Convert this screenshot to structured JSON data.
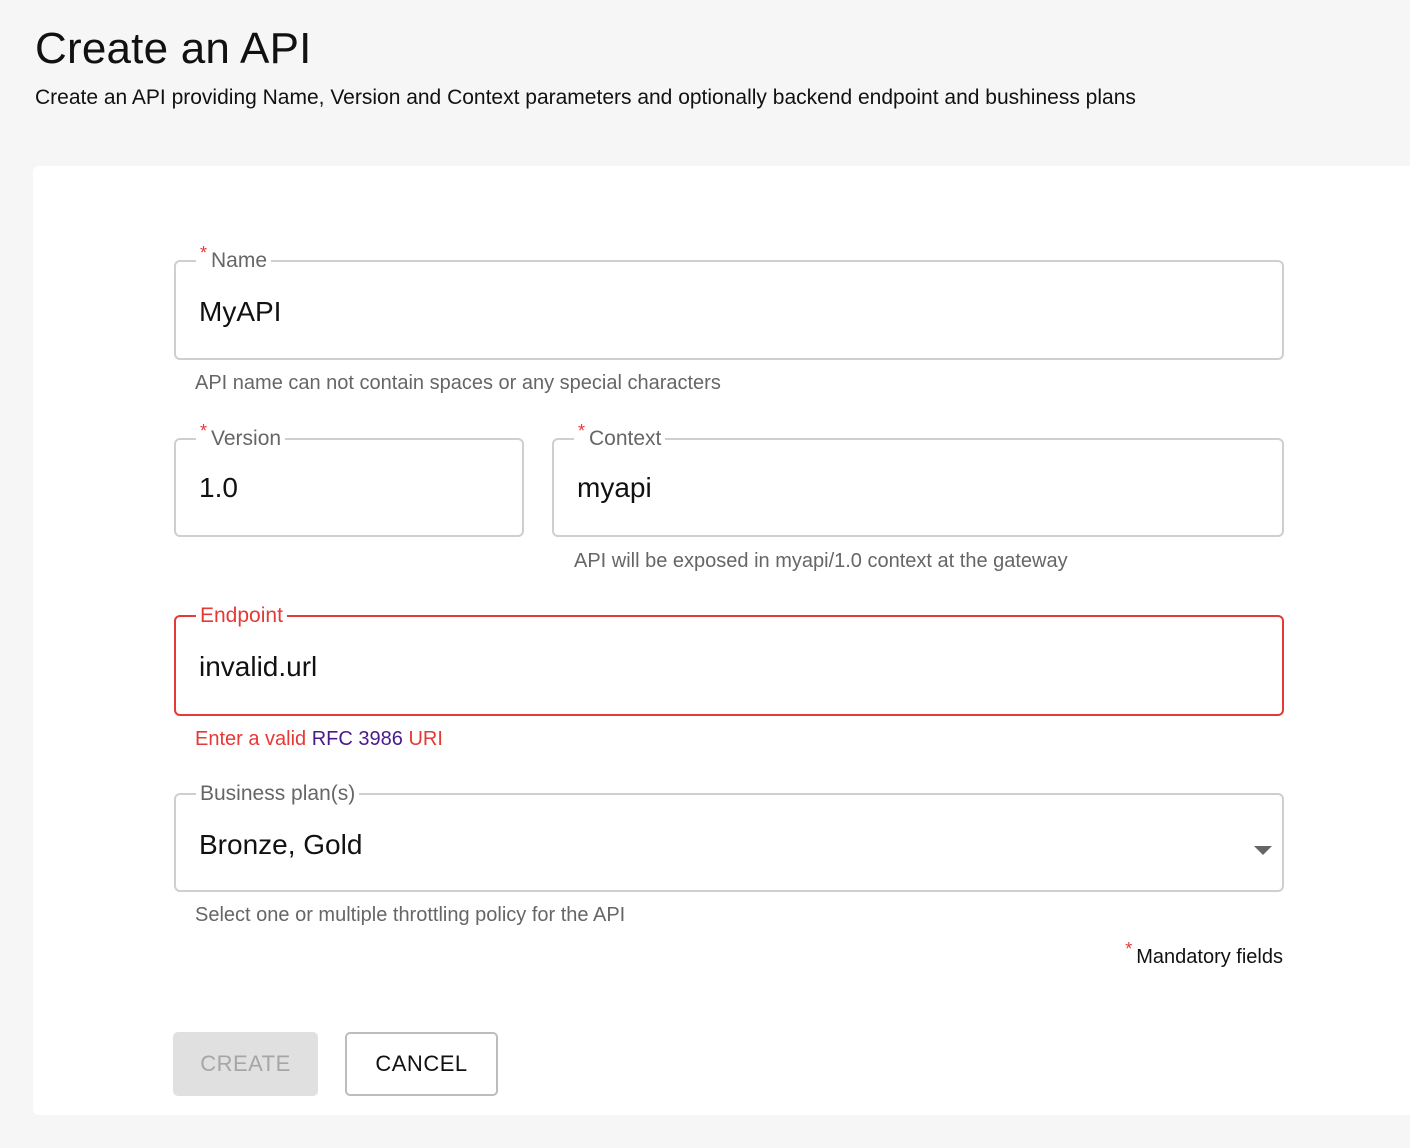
{
  "header": {
    "title": "Create an API",
    "subtitle": "Create an API providing Name, Version and Context parameters and optionally backend endpoint and bushiness plans"
  },
  "form": {
    "required_marker": "*",
    "name": {
      "label": "Name",
      "value": "MyAPI",
      "helper": "API name can not contain spaces or any special characters"
    },
    "version": {
      "label": "Version",
      "value": "1.0"
    },
    "context": {
      "label": "Context",
      "value": "myapi",
      "helper": "API will be exposed in myapi/1.0 context at the gateway"
    },
    "endpoint": {
      "label": "Endpoint",
      "value": "invalid.url",
      "error_prefix": "Enter a valid ",
      "error_link": "RFC 3986",
      "error_suffix": " URI"
    },
    "business_plans": {
      "label": "Business plan(s)",
      "value": "Bronze, Gold",
      "helper": "Select one or multiple throttling policy for the API"
    },
    "mandatory_note": "Mandatory fields"
  },
  "actions": {
    "create_label": "CREATE",
    "cancel_label": "CANCEL"
  },
  "colors": {
    "error": "#e53935",
    "border": "#cfcfcf",
    "link": "#4a1a8c"
  }
}
